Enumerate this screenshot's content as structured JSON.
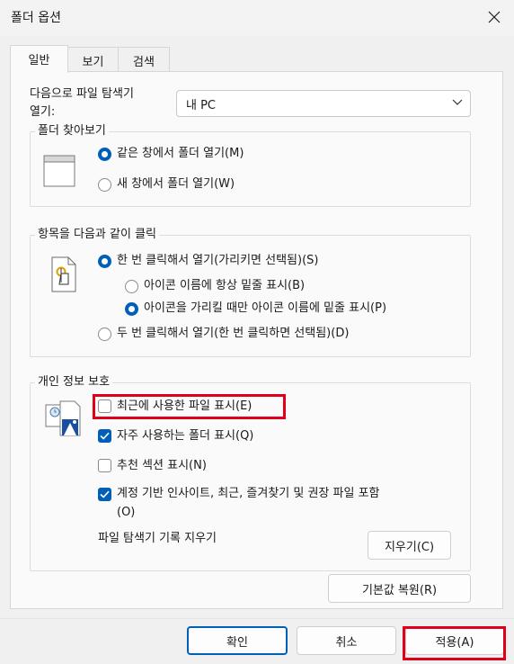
{
  "window": {
    "title": "폴더 옵션"
  },
  "tabs": [
    {
      "label": "일반"
    },
    {
      "label": "보기"
    },
    {
      "label": "검색"
    }
  ],
  "general": {
    "open_explorer_label_line1": "다음으로 파일 탐색기",
    "open_explorer_label_line2": "열기:",
    "open_explorer_value": "내 PC",
    "browse_group": {
      "title": "폴더 찾아보기",
      "options": [
        "같은 창에서 폴더 열기(M)",
        "새 창에서 폴더 열기(W)"
      ],
      "selected": 0
    },
    "click_group": {
      "title": "항목을 다음과 같이 클릭",
      "single_click": "한 번 클릭해서 열기(가리키면 선택됨)(S)",
      "underline_always": "아이콘 이름에 항상 밑줄 표시(B)",
      "underline_hover": "아이콘을 가리킬 때만 아이콘 이름에 밑줄 표시(P)",
      "double_click": "두 번 클릭해서 열기(한 번 클릭하면 선택됨)(D)"
    },
    "privacy_group": {
      "title": "개인 정보 보호",
      "show_recent": {
        "label": "최근에 사용한 파일 표시(E)",
        "checked": false
      },
      "show_frequent": {
        "label": "자주 사용하는 폴더 표시(Q)",
        "checked": true
      },
      "show_recommended": {
        "label": "추천 섹션 표시(N)",
        "checked": false
      },
      "show_account_line1": "계정 기반 인사이트, 최근, 즐겨찾기 및 권장 파일 포함",
      "show_account_line2": "(O)",
      "show_account_checked": true,
      "clear_history_label": "파일 탐색기 기록 지우기",
      "clear_button": "지우기(C)"
    },
    "restore_defaults": "기본값 복원(R)"
  },
  "footer": {
    "ok": "확인",
    "cancel": "취소",
    "apply": "적용(A)"
  },
  "colors": {
    "accent": "#005fb8",
    "highlight": "#e0001b"
  }
}
